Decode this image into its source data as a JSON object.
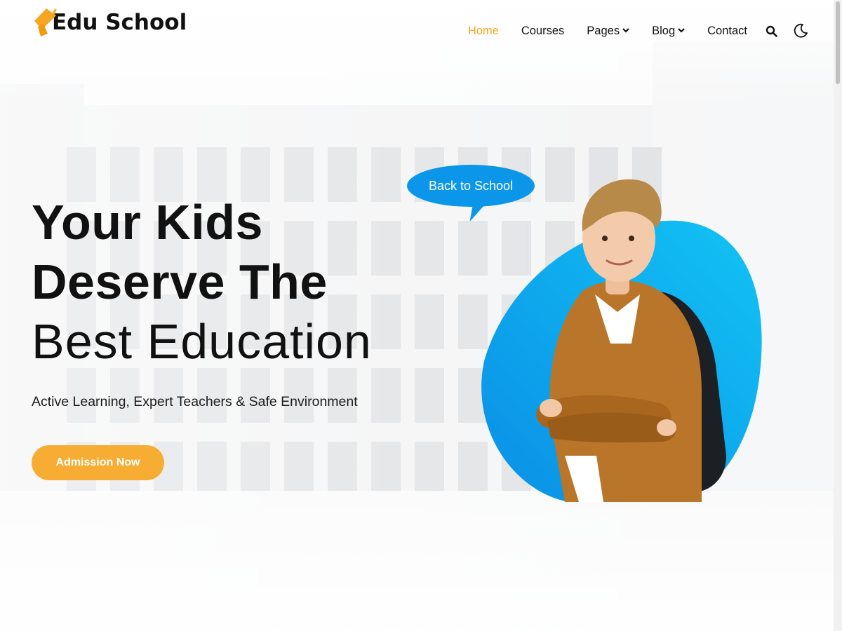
{
  "brand": {
    "name": "Edu School",
    "accent": "#f5a623",
    "primary": "#0b96ea"
  },
  "nav": {
    "items": [
      {
        "label": "Home",
        "active": true,
        "dropdown": false
      },
      {
        "label": "Courses",
        "active": false,
        "dropdown": false
      },
      {
        "label": "Pages",
        "active": false,
        "dropdown": true
      },
      {
        "label": "Blog",
        "active": false,
        "dropdown": true
      },
      {
        "label": "Contact",
        "active": false,
        "dropdown": false
      }
    ],
    "icons": [
      "search-icon",
      "moon-icon"
    ]
  },
  "hero": {
    "line1": "Your Kids",
    "line2": "Deserve The",
    "line3": "Best Education",
    "subtitle": "Active Learning, Expert Teachers & Safe Environment",
    "cta": "Admission Now",
    "bubble": "Back to School"
  }
}
